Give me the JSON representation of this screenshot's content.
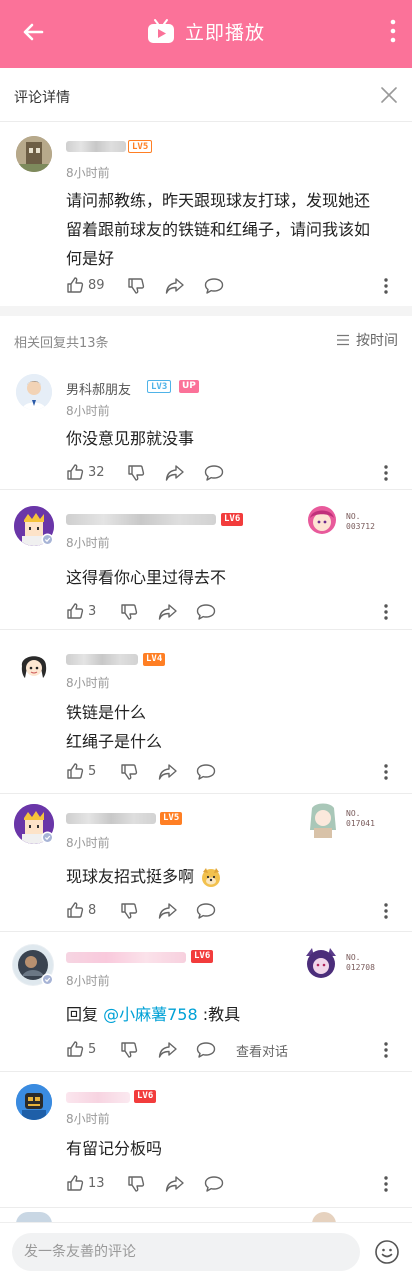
{
  "topbar": {
    "play_label": "立即播放",
    "accent": "#fb7299"
  },
  "detail": {
    "title": "评论详情"
  },
  "main_comment": {
    "level": "LV5",
    "time": "8小时前",
    "text_lines": [
      "请问郝教练，昨天跟现球友打球，发现她还",
      "留着跟前球友的铁链和红绳子，请问我该如",
      "何是好"
    ],
    "likes": "89"
  },
  "replies_header": {
    "count_label": "相关回复共13条",
    "sort_label": "按时间"
  },
  "replies": [
    {
      "username": "男科郝朋友",
      "level": "LV3",
      "up": "UP",
      "time": "8小时前",
      "lines": [
        "你没意见那就没事"
      ],
      "likes": "32"
    },
    {
      "level": "LV6",
      "time": "8小时前",
      "lines": [
        "这得看你心里过得去不"
      ],
      "likes": "3",
      "fan_no": "NO.\n003712"
    },
    {
      "level": "LV4",
      "time": "8小时前",
      "lines": [
        "铁链是什么",
        "红绳子是什么"
      ],
      "likes": "5"
    },
    {
      "level": "LV5",
      "time": "8小时前",
      "lines": [
        "现球友招式挺多啊"
      ],
      "likes": "8",
      "fan_no": "NO.\n017041"
    },
    {
      "level": "LV6",
      "time": "8小时前",
      "reply_prefix": "回复 ",
      "reply_target": "@小麻薯758",
      "reply_text": " :教具",
      "likes": "5",
      "see_conversation": "查看对话",
      "fan_no": "NO.\n012708"
    },
    {
      "level": "LV6",
      "time": "8小时前",
      "lines": [
        "有留记分板吗"
      ],
      "likes": "13"
    }
  ],
  "composer": {
    "placeholder": "发一条友善的评论"
  }
}
